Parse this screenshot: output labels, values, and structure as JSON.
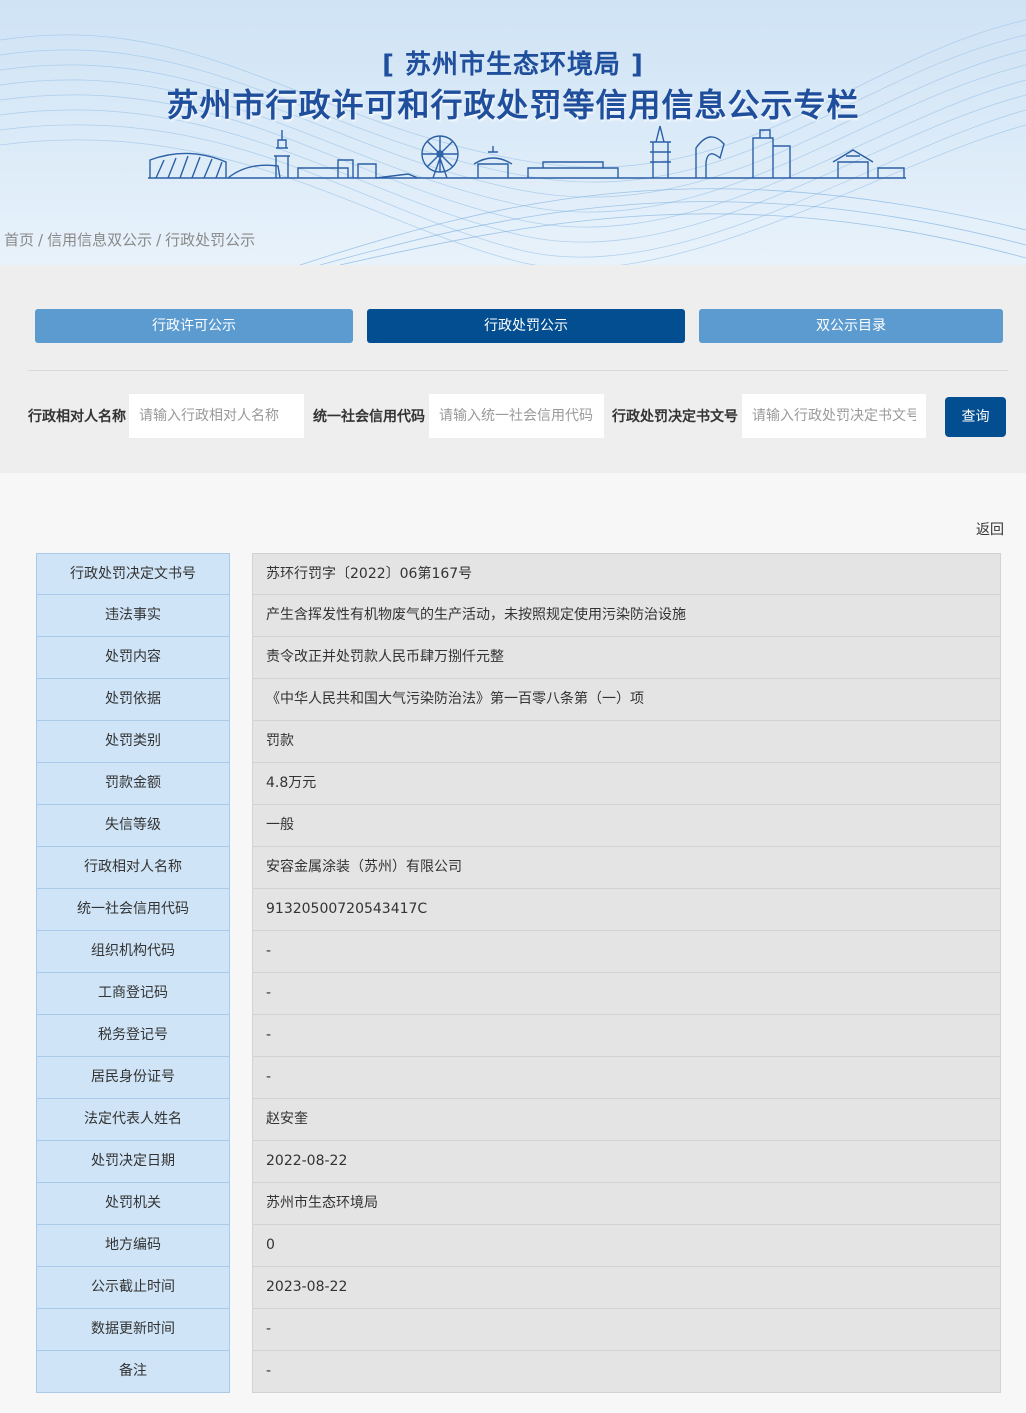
{
  "banner": {
    "subtitle": "[ 苏州市生态环境局 ]",
    "title": "苏州市行政许可和行政处罚等信用信息公示专栏"
  },
  "breadcrumb": {
    "home": "首页",
    "level2": "信用信息双公示",
    "current": "行政处罚公示",
    "separator": "/"
  },
  "tabs": [
    {
      "label": "行政许可公示"
    },
    {
      "label": "行政处罚公示"
    },
    {
      "label": "双公示目录"
    }
  ],
  "search": {
    "name_label": "行政相对人名称",
    "name_placeholder": "请输入行政相对人名称",
    "credit_label": "统一社会信用代码",
    "credit_placeholder": "请输入统一社会信用代码",
    "doc_label": "行政处罚决定书文号",
    "doc_placeholder": "请输入行政处罚决定书文号",
    "button": "查询"
  },
  "back_label": "返回",
  "details": [
    {
      "label": "行政处罚决定文书号",
      "value": "苏环行罚字〔2022〕06第167号"
    },
    {
      "label": "违法事实",
      "value": "产生含挥发性有机物废气的生产活动，未按照规定使用污染防治设施"
    },
    {
      "label": "处罚内容",
      "value": "责令改正并处罚款人民币肆万捌仟元整"
    },
    {
      "label": "处罚依据",
      "value": "《中华人民共和国大气污染防治法》第一百零八条第（一）项"
    },
    {
      "label": "处罚类别",
      "value": "罚款"
    },
    {
      "label": "罚款金额",
      "value": "4.8万元"
    },
    {
      "label": "失信等级",
      "value": "一般"
    },
    {
      "label": "行政相对人名称",
      "value": "安容金属涂装（苏州）有限公司"
    },
    {
      "label": "统一社会信用代码",
      "value": "91320500720543417C"
    },
    {
      "label": "组织机构代码",
      "value": "-"
    },
    {
      "label": "工商登记码",
      "value": "-"
    },
    {
      "label": "税务登记号",
      "value": "-"
    },
    {
      "label": "居民身份证号",
      "value": "-"
    },
    {
      "label": "法定代表人姓名",
      "value": "赵安奎"
    },
    {
      "label": "处罚决定日期",
      "value": "2022-08-22"
    },
    {
      "label": "处罚机关",
      "value": "苏州市生态环境局"
    },
    {
      "label": "地方编码",
      "value": "0"
    },
    {
      "label": "公示截止时间",
      "value": "2023-08-22"
    },
    {
      "label": "数据更新时间",
      "value": "-"
    },
    {
      "label": "备注",
      "value": "-"
    }
  ],
  "colors": {
    "primary": "#024e90",
    "tab_inactive": "#5b9bd0",
    "label_cell": "#cfe4f7",
    "value_cell": "#e4e4e4",
    "title": "#1f4f9c"
  }
}
